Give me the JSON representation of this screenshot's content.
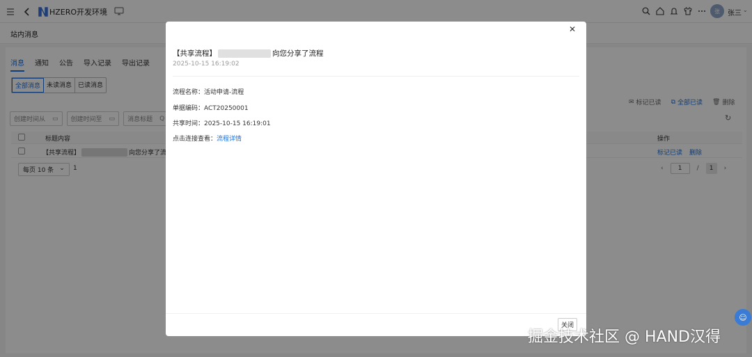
{
  "topbar": {
    "app_title": "HZERO开发环境",
    "avatar_text": "张",
    "user_name": "张三"
  },
  "subheader": {
    "title": "站内消息"
  },
  "tabs": [
    {
      "label": "消息",
      "active": true
    },
    {
      "label": "通知",
      "active": false
    },
    {
      "label": "公告",
      "active": false
    },
    {
      "label": "导入记录",
      "active": false
    },
    {
      "label": "导出记录",
      "active": false
    }
  ],
  "segments": [
    {
      "label": "全部消息",
      "active": true
    },
    {
      "label": "未读消息",
      "active": false
    },
    {
      "label": "已读消息",
      "active": false
    }
  ],
  "filters": [
    {
      "placeholder": "创建时间从"
    },
    {
      "placeholder": "创建时间至"
    },
    {
      "placeholder": "消息标题"
    }
  ],
  "actions": {
    "mark_read": "标记已读",
    "mark_all_read": "全部已读",
    "delete": "删除"
  },
  "table": {
    "col_title": "标题内容",
    "col_op": "操作",
    "rows": [
      {
        "prefix": "【共享流程】",
        "suffix": "向您分享了流程",
        "op_read": "标记已读",
        "op_delete": "删除"
      }
    ]
  },
  "pagination": {
    "page_size": "每页 10 条",
    "total": "1",
    "current": "1",
    "separator": "/",
    "pages": "1"
  },
  "modal": {
    "title_prefix": "【共享流程】",
    "title_suffix": "向您分享了流程",
    "time": "2025-10-15 16:19:02",
    "fields": {
      "flow_name": "流程名称：活动申请-流程",
      "doc_code": "单据编码：ACT20250001",
      "share_time": "共享时间：2025-10-15 16:19:01",
      "view_prefix": "点击连接查看：",
      "view_link": "流程详情"
    },
    "close_button": "关闭"
  },
  "watermark": "掘金技术社区 @ HAND汉得"
}
